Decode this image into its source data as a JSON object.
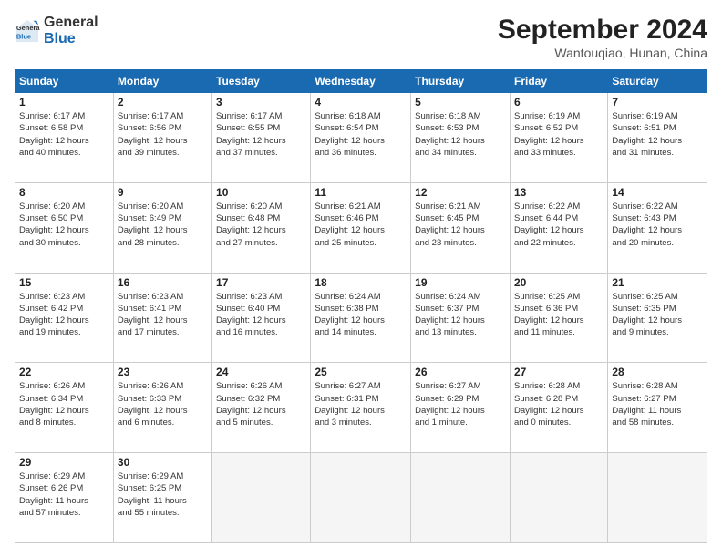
{
  "logo": {
    "line1": "General",
    "line2": "Blue"
  },
  "title": "September 2024",
  "location": "Wantouqiao, Hunan, China",
  "weekdays": [
    "Sunday",
    "Monday",
    "Tuesday",
    "Wednesday",
    "Thursday",
    "Friday",
    "Saturday"
  ],
  "weeks": [
    [
      {
        "day": "1",
        "info": "Sunrise: 6:17 AM\nSunset: 6:58 PM\nDaylight: 12 hours\nand 40 minutes."
      },
      {
        "day": "2",
        "info": "Sunrise: 6:17 AM\nSunset: 6:56 PM\nDaylight: 12 hours\nand 39 minutes."
      },
      {
        "day": "3",
        "info": "Sunrise: 6:17 AM\nSunset: 6:55 PM\nDaylight: 12 hours\nand 37 minutes."
      },
      {
        "day": "4",
        "info": "Sunrise: 6:18 AM\nSunset: 6:54 PM\nDaylight: 12 hours\nand 36 minutes."
      },
      {
        "day": "5",
        "info": "Sunrise: 6:18 AM\nSunset: 6:53 PM\nDaylight: 12 hours\nand 34 minutes."
      },
      {
        "day": "6",
        "info": "Sunrise: 6:19 AM\nSunset: 6:52 PM\nDaylight: 12 hours\nand 33 minutes."
      },
      {
        "day": "7",
        "info": "Sunrise: 6:19 AM\nSunset: 6:51 PM\nDaylight: 12 hours\nand 31 minutes."
      }
    ],
    [
      {
        "day": "8",
        "info": "Sunrise: 6:20 AM\nSunset: 6:50 PM\nDaylight: 12 hours\nand 30 minutes."
      },
      {
        "day": "9",
        "info": "Sunrise: 6:20 AM\nSunset: 6:49 PM\nDaylight: 12 hours\nand 28 minutes."
      },
      {
        "day": "10",
        "info": "Sunrise: 6:20 AM\nSunset: 6:48 PM\nDaylight: 12 hours\nand 27 minutes."
      },
      {
        "day": "11",
        "info": "Sunrise: 6:21 AM\nSunset: 6:46 PM\nDaylight: 12 hours\nand 25 minutes."
      },
      {
        "day": "12",
        "info": "Sunrise: 6:21 AM\nSunset: 6:45 PM\nDaylight: 12 hours\nand 23 minutes."
      },
      {
        "day": "13",
        "info": "Sunrise: 6:22 AM\nSunset: 6:44 PM\nDaylight: 12 hours\nand 22 minutes."
      },
      {
        "day": "14",
        "info": "Sunrise: 6:22 AM\nSunset: 6:43 PM\nDaylight: 12 hours\nand 20 minutes."
      }
    ],
    [
      {
        "day": "15",
        "info": "Sunrise: 6:23 AM\nSunset: 6:42 PM\nDaylight: 12 hours\nand 19 minutes."
      },
      {
        "day": "16",
        "info": "Sunrise: 6:23 AM\nSunset: 6:41 PM\nDaylight: 12 hours\nand 17 minutes."
      },
      {
        "day": "17",
        "info": "Sunrise: 6:23 AM\nSunset: 6:40 PM\nDaylight: 12 hours\nand 16 minutes."
      },
      {
        "day": "18",
        "info": "Sunrise: 6:24 AM\nSunset: 6:38 PM\nDaylight: 12 hours\nand 14 minutes."
      },
      {
        "day": "19",
        "info": "Sunrise: 6:24 AM\nSunset: 6:37 PM\nDaylight: 12 hours\nand 13 minutes."
      },
      {
        "day": "20",
        "info": "Sunrise: 6:25 AM\nSunset: 6:36 PM\nDaylight: 12 hours\nand 11 minutes."
      },
      {
        "day": "21",
        "info": "Sunrise: 6:25 AM\nSunset: 6:35 PM\nDaylight: 12 hours\nand 9 minutes."
      }
    ],
    [
      {
        "day": "22",
        "info": "Sunrise: 6:26 AM\nSunset: 6:34 PM\nDaylight: 12 hours\nand 8 minutes."
      },
      {
        "day": "23",
        "info": "Sunrise: 6:26 AM\nSunset: 6:33 PM\nDaylight: 12 hours\nand 6 minutes."
      },
      {
        "day": "24",
        "info": "Sunrise: 6:26 AM\nSunset: 6:32 PM\nDaylight: 12 hours\nand 5 minutes."
      },
      {
        "day": "25",
        "info": "Sunrise: 6:27 AM\nSunset: 6:31 PM\nDaylight: 12 hours\nand 3 minutes."
      },
      {
        "day": "26",
        "info": "Sunrise: 6:27 AM\nSunset: 6:29 PM\nDaylight: 12 hours\nand 1 minute."
      },
      {
        "day": "27",
        "info": "Sunrise: 6:28 AM\nSunset: 6:28 PM\nDaylight: 12 hours\nand 0 minutes."
      },
      {
        "day": "28",
        "info": "Sunrise: 6:28 AM\nSunset: 6:27 PM\nDaylight: 11 hours\nand 58 minutes."
      }
    ],
    [
      {
        "day": "29",
        "info": "Sunrise: 6:29 AM\nSunset: 6:26 PM\nDaylight: 11 hours\nand 57 minutes."
      },
      {
        "day": "30",
        "info": "Sunrise: 6:29 AM\nSunset: 6:25 PM\nDaylight: 11 hours\nand 55 minutes."
      },
      null,
      null,
      null,
      null,
      null
    ]
  ]
}
